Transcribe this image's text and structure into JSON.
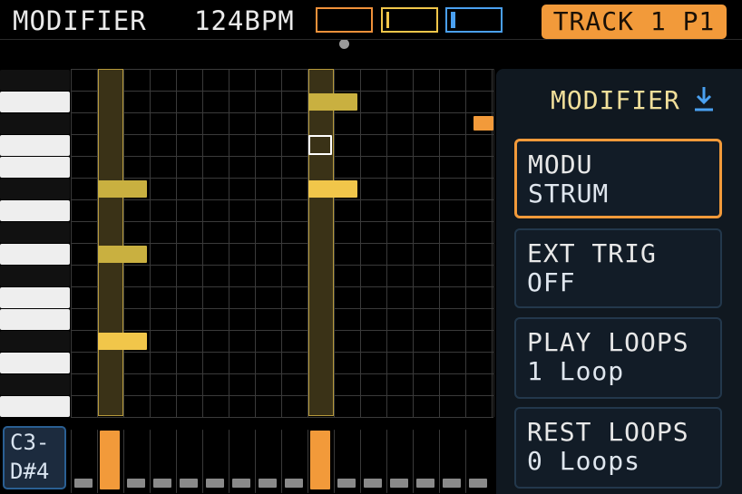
{
  "header": {
    "title": "MODIFIER",
    "bpm": "124BPM",
    "track": "TRACK 1 P1",
    "colors": {
      "orange": "#f29a3a",
      "yellow": "#f1c64a",
      "blue": "#4aa0f0"
    }
  },
  "keyboard": {
    "range_line1": "C3-",
    "range_line2": "D#4"
  },
  "panel": {
    "title": "MODIFIER",
    "title_icon": "download-arrow-icon",
    "items": [
      {
        "label": "MODU",
        "value": "STRUM",
        "selected": true
      },
      {
        "label": "EXT TRIG",
        "value": "OFF",
        "selected": false
      },
      {
        "label": "PLAY LOOPS",
        "value": "1 Loop",
        "selected": false
      },
      {
        "label": "REST LOOPS",
        "value": "0 Loops",
        "selected": false
      }
    ]
  }
}
